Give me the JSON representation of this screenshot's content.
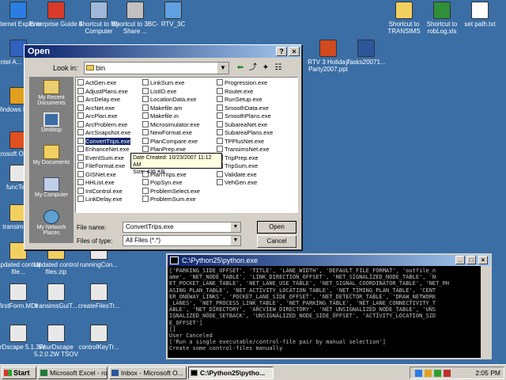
{
  "desktop_icons": [
    {
      "label": "Internet Explorer",
      "color": "#2a7de1"
    },
    {
      "label": "Enterprise Guide 4",
      "color": "#d83b2a"
    },
    {
      "label": "Shortcut to My Computer",
      "color": "#9fb8d8"
    },
    {
      "label": "Shortcut to 3BC-Share ...",
      "color": "#c0c0c0"
    },
    {
      "label": "RTV_3C",
      "color": "#5fa0e0"
    },
    {
      "label": "Shortcut to TRANSIMS",
      "color": "#f2d060"
    },
    {
      "label": "Shortcut to robLog.xls",
      "color": "#2f8f3a"
    },
    {
      "label": "set path.txt",
      "color": "#ffffff"
    },
    {
      "label": "Intel A... Studi",
      "color": "#3060c0"
    },
    {
      "label": "RTV 3 Holiday Party2007.ppt",
      "color": "#d04a20"
    },
    {
      "label": "Tasks20071...",
      "color": "#2b579a"
    },
    {
      "label": "Windows Player",
      "color": "#e0a020"
    },
    {
      "label": "Microsoft Office On",
      "color": "#e05020"
    },
    {
      "label": "funcTe...",
      "color": "#e8e8e8"
    },
    {
      "label": "transims-...",
      "color": "#f2d060"
    },
    {
      "label": "Updated control file...",
      "color": "#f2d060"
    },
    {
      "label": "Updated control files.zip",
      "color": "#f2d060"
    },
    {
      "label": "runningCon...",
      "color": "#e8e8e8"
    },
    {
      "label": "firstForm.MDI",
      "color": "#e8e8e8"
    },
    {
      "label": "transimsGuiT...",
      "color": "#e8e8e8"
    },
    {
      "label": "createFilesTr...",
      "color": "#e8e8e8"
    },
    {
      "label": "fourDscape 5.1.3W",
      "color": "#e8e8e8"
    },
    {
      "label": "FourDscape 5.2.0.2W TSOV",
      "color": "#e8e8e8"
    },
    {
      "label": "controlKeyTr...",
      "color": "#e8e8e8"
    }
  ],
  "dialog": {
    "title": "Open",
    "help_btn": "?",
    "close_btn": "×",
    "look_in_label": "Look in:",
    "look_in_value": "bin",
    "places": [
      "My Recent Documents",
      "Desktop",
      "My Documents",
      "My Computer",
      "My Network Places"
    ],
    "files_col1": [
      "ActGen.exe",
      "AdjustPlans.exe",
      "ArcDelay.exe",
      "ArcNet.exe",
      "ArcPlan.exe",
      "ArcProblem.exe",
      "ArcSnapshot.exe",
      "ConvertTrips.exe",
      "EnhanceNet.exe",
      "EventSum.exe",
      "FileFormat.exe",
      "GISNet.exe",
      "HHList.exe",
      "IntControl.exe",
      "LinkDelay.exe"
    ],
    "files_col2": [
      "LinkSum.exe",
      "ListID.exe",
      "LocationData.exe",
      "Makefile.am",
      "Makefile.in",
      "Microsimulator.exe",
      "NewFormat.exe",
      "PlanCompare.exe",
      "PlanPrep.exe",
      "PlanSelect.exe",
      "PlanSum.exe",
      "PlanTrips.exe",
      "PopSyn.exe",
      "ProblemSelect.exe",
      "ProblemSum.exe"
    ],
    "files_col3": [
      "Progression.exe",
      "Router.exe",
      "RunSetup.exe",
      "SmoothData.exe",
      "SmoothPlans.exe",
      "SubareaNet.exe",
      "SubareaPlans.exe",
      "TPPlusNet.exe",
      "TransimsNet.exe",
      "TripPrep.exe",
      "TripSum.exe",
      "Validate.exe",
      "VehGen.exe"
    ],
    "selected_file": "ConvertTrips.exe",
    "tooltip_line1": "Date Created: 10/23/2007 11:12 AM",
    "tooltip_line2": "Size: 436 KB",
    "filename_label": "File name:",
    "filename_value": "ConvertTrips.exe",
    "filetype_label": "Files of type:",
    "filetype_value": "All Files (*.*)",
    "open_btn": "Open",
    "cancel_btn": "Cancel"
  },
  "console": {
    "title": "C:\\Python25\\python.exe",
    "lines": [
      "['PARKING_SIDE_OFFSET', 'TITLE', 'LANE_WIDTH', 'DEFAULT_FILE_FORMAT', 'outfile_n",
      "ame', 'NET_NODE_TABLE', 'LINK_DIRECTION_OFFSET', 'NET_SIGNALIZED_NODE_TABLE', 'N",
      "ET_POCKET_LANE_TABLE', 'NET_LANE_USE_TABLE', 'NET_SIGNAL_COORDINATOR_TABLE', 'NET_PH",
      "ASING_PLAN_TABLE', 'NET_ACTIVITY_LOCATION_TABLE', 'NET_TIMING_PLAN_TABLE', 'CENT",
      "ER_ONEWAY_LINKS', 'POCKET_LANE_SIDE_OFFSET', 'NET_DETECTOR_TABLE', 'DRAW_NETWORK",
      "_LANES', 'NET_PROCESS_LINK_TABLE', 'NET_PARKING_TABLE', 'NET_LANE_CONNECTIVITY_T",
      "ABLE', 'NET_DIRECTORY', 'ARCVIEW_DIRECTORY', 'NET_UNSIGNALIZED_NODE_TABLE', 'UNS",
      "IGNALIZED_NODE_SETBACK', 'UNSIGNALIZED_NODE_SIDE_OFFSET', 'ACTIVITY_LOCATION_SID",
      "E_OFFSET']",
      "[]",
      "User Canceled",
      "['Run a single executable/control-file pair by manual selection']",
      "Create some control-files manually"
    ]
  },
  "taskbar": {
    "start": "Start",
    "tasks": [
      "Microsoft Excel - ro...",
      "Inbox - Microsoft O...",
      "C:\\Python25\\pytho..."
    ],
    "clock": "2:05 PM"
  }
}
